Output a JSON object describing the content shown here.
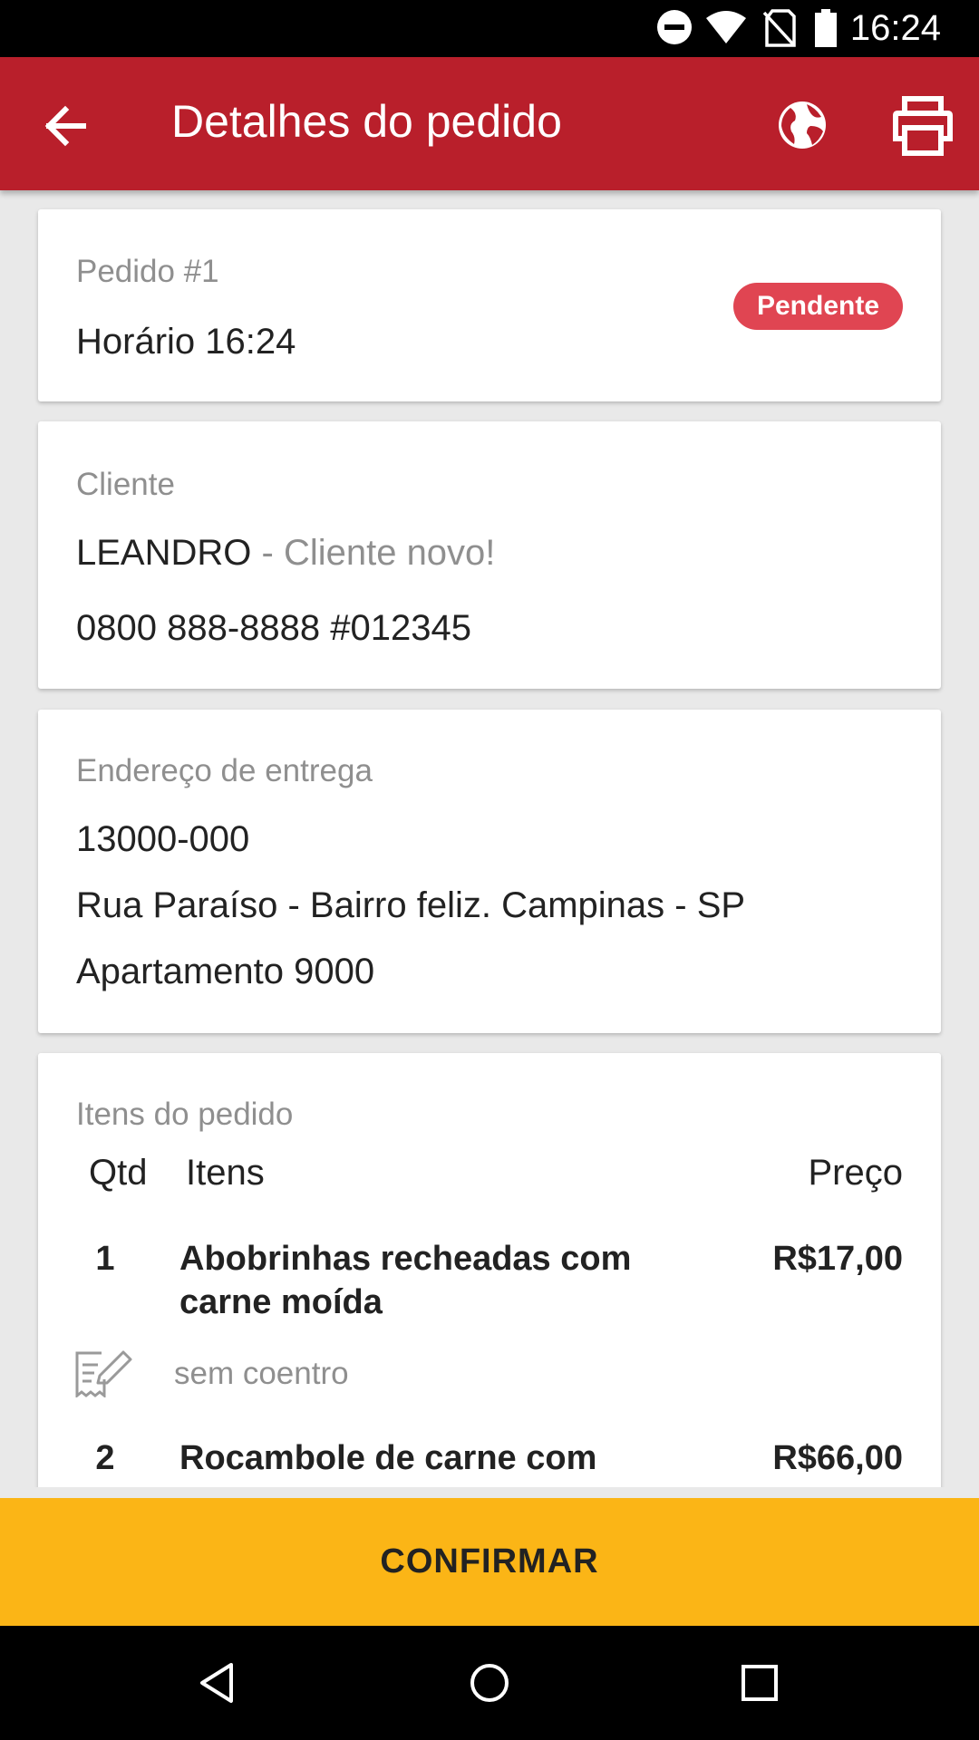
{
  "status_bar": {
    "time": "16:24"
  },
  "app_bar": {
    "title": "Detalhes do pedido"
  },
  "order": {
    "number_label": "Pedido #1",
    "time_label": "Horário 16:24",
    "status": "Pendente"
  },
  "customer": {
    "section_label": "Cliente",
    "name": "LEANDRO",
    "tag": " - Cliente novo!",
    "phone": "0800 888-8888 #012345"
  },
  "address": {
    "section_label": "Endereço de entrega",
    "zip": "13000-000",
    "street": "Rua Paraíso - Bairro feliz. Campinas - SP",
    "complement": "Apartamento 9000"
  },
  "items": {
    "section_label": "Itens do pedido",
    "headers": {
      "qty": "Qtd",
      "item": "Itens",
      "price": "Preço"
    },
    "rows": [
      {
        "qty": "1",
        "name": "Abobrinhas recheadas com carne moída",
        "price": "R$17,00",
        "note": "sem coentro"
      },
      {
        "qty": "2",
        "name": "Rocambole de carne com",
        "price": "R$66,00"
      }
    ]
  },
  "confirm": {
    "label": "CONFIRMAR"
  },
  "colors": {
    "primary": "#b91f2b",
    "accent": "#fbb516",
    "badge": "#e04552"
  },
  "icons": [
    "back-arrow-icon",
    "globe-icon",
    "printer-icon",
    "note-edit-icon",
    "dnd-icon",
    "wifi-icon",
    "no-sim-icon",
    "battery-icon",
    "nav-back-icon",
    "nav-home-icon",
    "nav-recents-icon"
  ]
}
